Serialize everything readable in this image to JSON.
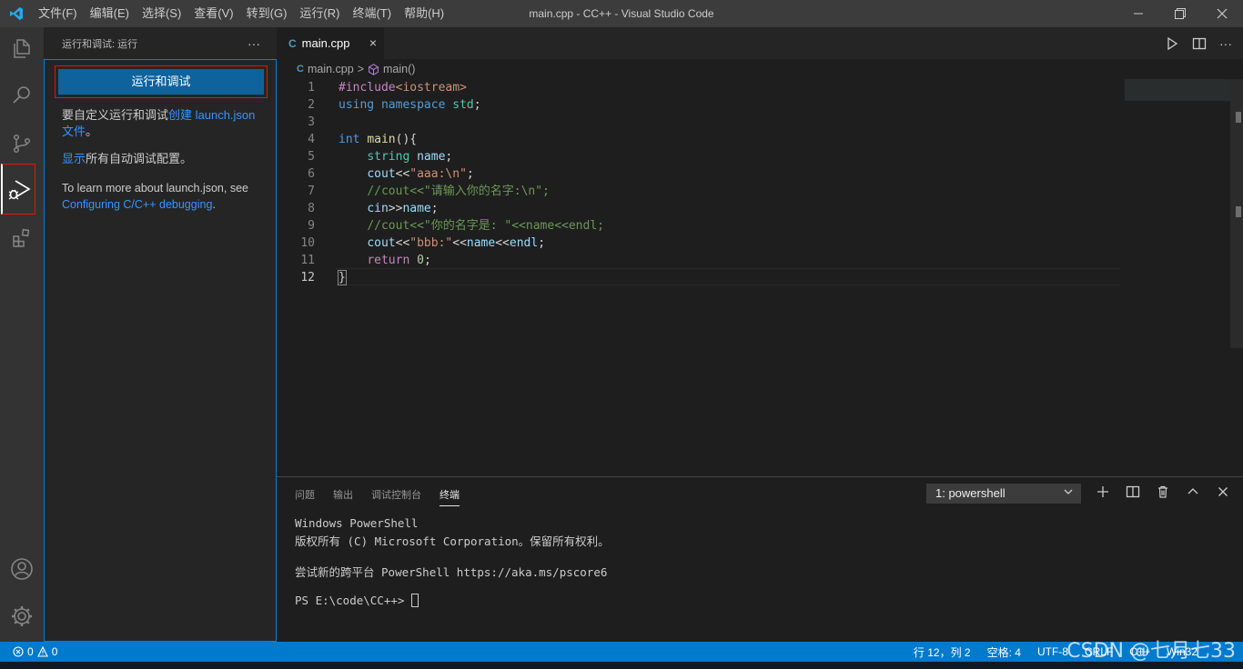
{
  "window": {
    "title": "main.cpp - CC++ - Visual Studio Code",
    "menu": [
      "文件(F)",
      "编辑(E)",
      "选择(S)",
      "查看(V)",
      "转到(G)",
      "运行(R)",
      "终端(T)",
      "帮助(H)"
    ]
  },
  "activity_bar": {
    "items": [
      "explorer-icon",
      "search-icon",
      "source-control-icon",
      "run-debug-icon",
      "extensions-icon"
    ],
    "bottom": [
      "account-icon",
      "manage-gear-icon"
    ],
    "active": "run-debug-icon"
  },
  "sidebar": {
    "title": "运行和调试: 运行",
    "more": "···",
    "run_button": "运行和调试",
    "customize_prefix": "要自定义运行和调试",
    "customize_link": "创建 launch.json",
    "customize_link2": "文件",
    "customize_suffix": "。",
    "show_link": "显示",
    "show_suffix": "所有自动调试配置。",
    "learn_prefix": "To learn more about launch.json, see",
    "learn_link": "Configuring C/C++ debugging",
    "learn_suffix": "."
  },
  "editor": {
    "tab_label": "main.cpp",
    "tab_close": "×",
    "breadcrumb_file": "main.cpp",
    "breadcrumb_sep": ">",
    "breadcrumb_symbol": "main()",
    "line_numbers": [
      "1",
      "2",
      "3",
      "4",
      "5",
      "6",
      "7",
      "8",
      "9",
      "10",
      "11",
      "12"
    ],
    "current_line": "12"
  },
  "panel": {
    "tabs": [
      "问题",
      "输出",
      "调试控制台",
      "终端"
    ],
    "active_tab": "终端",
    "terminal_select": "1: powershell",
    "terminal_lines": [
      "Windows PowerShell",
      "版权所有 (C) Microsoft Corporation。保留所有权利。",
      "",
      "尝试新的跨平台 PowerShell https://aka.ms/pscore6",
      "",
      "PS E:\\code\\CC++> "
    ]
  },
  "statusbar": {
    "errors": "0",
    "warnings": "0",
    "position": "行 12，列 2",
    "spaces": "空格: 4",
    "encoding": "UTF-8",
    "eol": "CRLF",
    "language": "C++",
    "platform": "Win32"
  },
  "watermark": "CSDN @七月七33",
  "colors": {
    "accent": "#007acc",
    "button": "#0e639c",
    "highlight_border": "#e51400",
    "link": "#3794ff"
  }
}
